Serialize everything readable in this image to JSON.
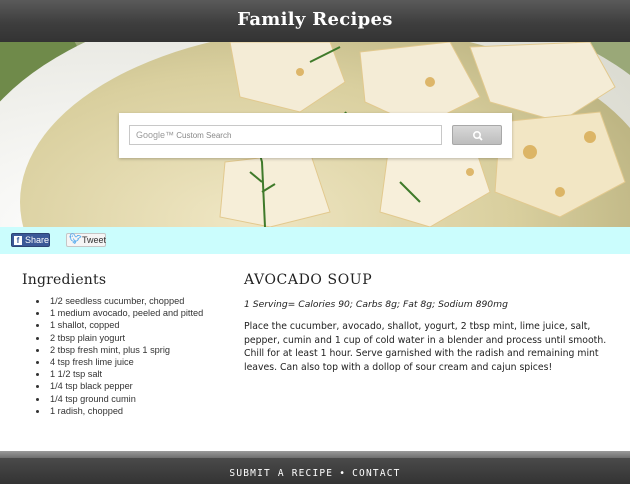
{
  "header": {
    "title": "Family Recipes"
  },
  "search": {
    "brand": "Google™",
    "placeholder": "Custom Search",
    "button_icon": "search-icon"
  },
  "share": {
    "facebook_label": "Share",
    "facebook_icon": "facebook-icon",
    "twitter_label": "Tweet",
    "twitter_icon": "twitter-icon"
  },
  "ingredients": {
    "title": "Ingredients",
    "items": [
      "1/2 seedless cucumber, chopped",
      "1 medium avocado, peeled and pitted",
      "1 shallot, copped",
      "2 tbsp plain yogurt",
      "2 tbsp fresh mint, plus 1 sprig",
      "4 tsp fresh lime juice",
      "1 1/2 tsp salt",
      "1/4 tsp black pepper",
      "1/4 tsp ground cumin",
      "1 radish, chopped"
    ]
  },
  "recipe": {
    "title": "AVOCADO SOUP",
    "nutrition": "1 Serving= Calories 90; Carbs 8g; Fat 8g; Sodium 890mg",
    "body": "Place the cucumber, avocado, shallot, yogurt, 2 tbsp mint, lime juice, salt, pepper, cumin and 1 cup of cold water in a blender and process until smooth. Chill for at least 1 hour. Serve garnished with the radish and remaining mint leaves. Can also top with a dollop of sour cream and cajun spices!"
  },
  "footer": {
    "submit_label": "SUBMIT A RECIPE",
    "separator": "•",
    "contact_label": "CONTACT"
  },
  "colors": {
    "share_bar": "#cbfdfd",
    "facebook": "#3b5998",
    "header": "#444444"
  }
}
